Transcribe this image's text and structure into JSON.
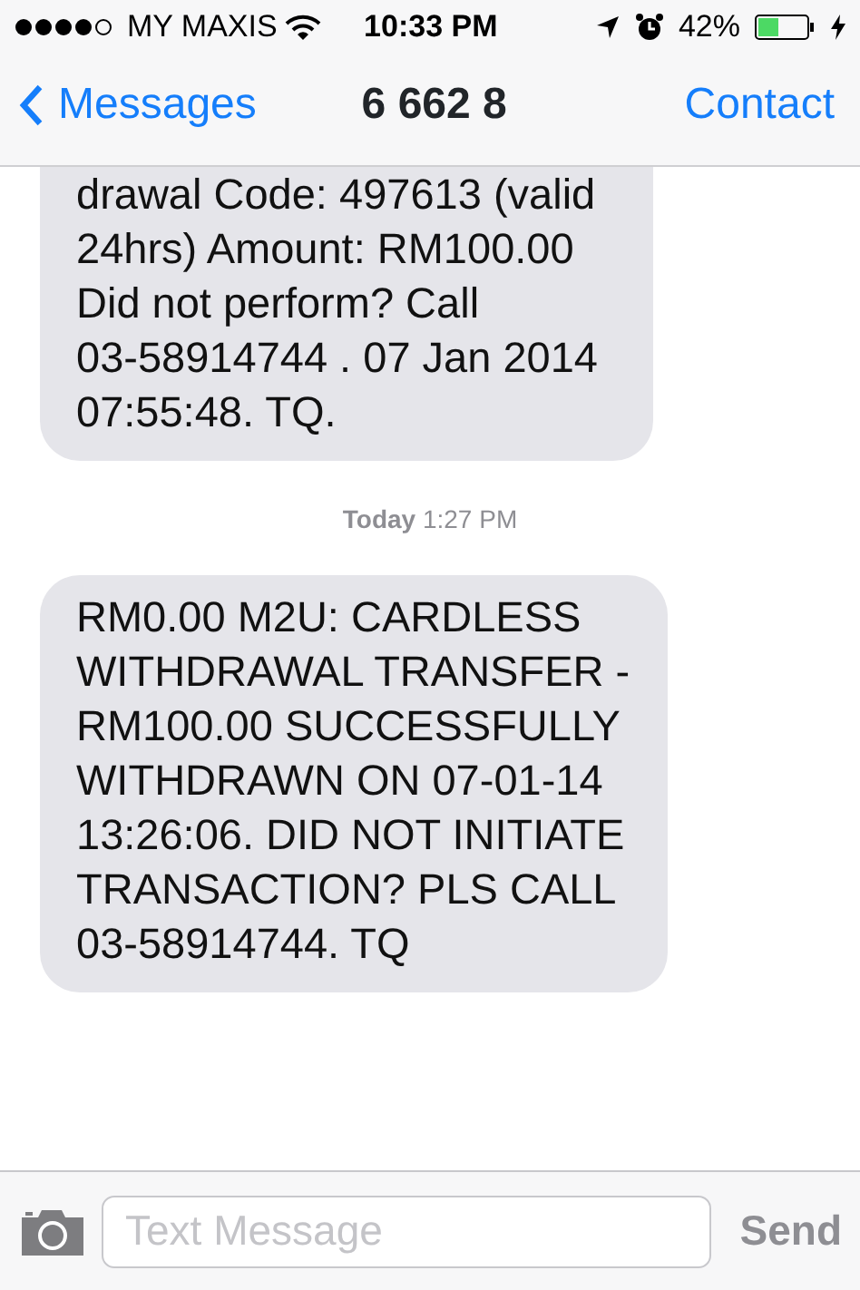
{
  "status_bar": {
    "carrier": "MY MAXIS",
    "time": "10:33 PM",
    "battery": "42%"
  },
  "nav": {
    "back": "Messages",
    "title": "6 662 8",
    "action": "Contact"
  },
  "messages": [
    {
      "kind": "message",
      "parts": [
        {
          "kind": "text",
          "text": "drawal Code: "
        },
        {
          "kind": "link",
          "text": "497613"
        },
        {
          "kind": "text",
          "text": " (valid 24hrs) Amount: RM100.00 Did not perform? Call "
        },
        {
          "kind": "link",
          "text": "03-58914744"
        },
        {
          "kind": "text",
          "text": " . 07 Jan 2014 07:55:48. TQ."
        }
      ]
    },
    {
      "kind": "timestamp",
      "day": "Today",
      "time": "1:27 PM"
    },
    {
      "kind": "message",
      "parts": [
        {
          "kind": "text",
          "text": "RM0.00 M2U: CARDLESS WITHDRAWAL TRANSFER - RM100.00 SUCCESSFULLY WITHDRAWN ON 07-01-14 13:26:06. DID NOT INITIATE TRANSACTION? PLS CALL "
        },
        {
          "kind": "link",
          "text": "03-58914744"
        },
        {
          "kind": "text",
          "text": ". TQ"
        }
      ]
    }
  ],
  "composer": {
    "placeholder": "Text Message",
    "send": "Send"
  }
}
